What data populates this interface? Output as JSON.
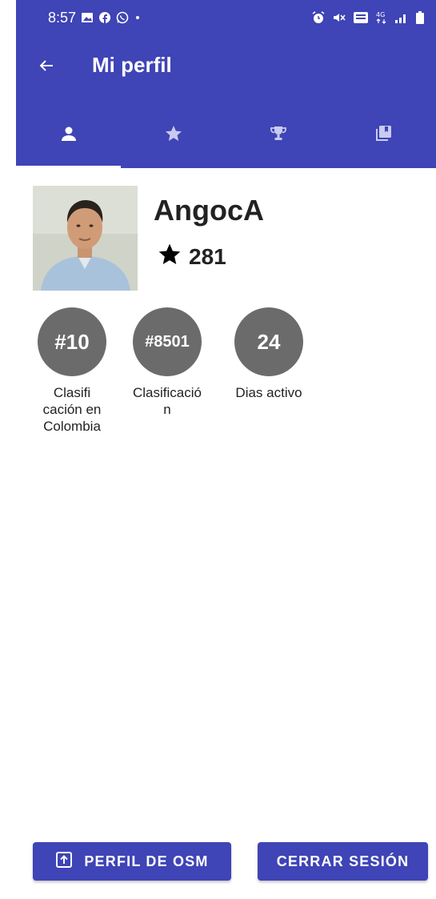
{
  "status_bar": {
    "time": "8:57",
    "icons_left": [
      "gallery-icon",
      "facebook-icon",
      "whatsapp-icon",
      "dot-icon"
    ],
    "icons_right": [
      "alarm-icon",
      "mute-icon",
      "volte-icon",
      "4g-icon",
      "signal-icon",
      "battery-icon"
    ]
  },
  "app_bar": {
    "title": "Mi perfil",
    "back_icon": "arrow-left-icon"
  },
  "tabs": [
    {
      "icon": "person-icon",
      "active": true
    },
    {
      "icon": "star-icon",
      "active": false
    },
    {
      "icon": "trophy-icon",
      "active": false
    },
    {
      "icon": "collections-icon",
      "active": false
    }
  ],
  "profile": {
    "username": "AngocA",
    "points": "281"
  },
  "stats": [
    {
      "value": "#10",
      "label": "Clasifi cación en Colombia"
    },
    {
      "value": "#8501",
      "label": "Clasificació n"
    },
    {
      "value": "24",
      "label": "Dias activo"
    }
  ],
  "buttons": {
    "osm_profile": "PERFIL DE OSM",
    "logout": "CERRAR SESIÓN"
  },
  "colors": {
    "primary": "#3f44b6",
    "stat_circle": "#6b6b6b",
    "text": "#222222"
  }
}
